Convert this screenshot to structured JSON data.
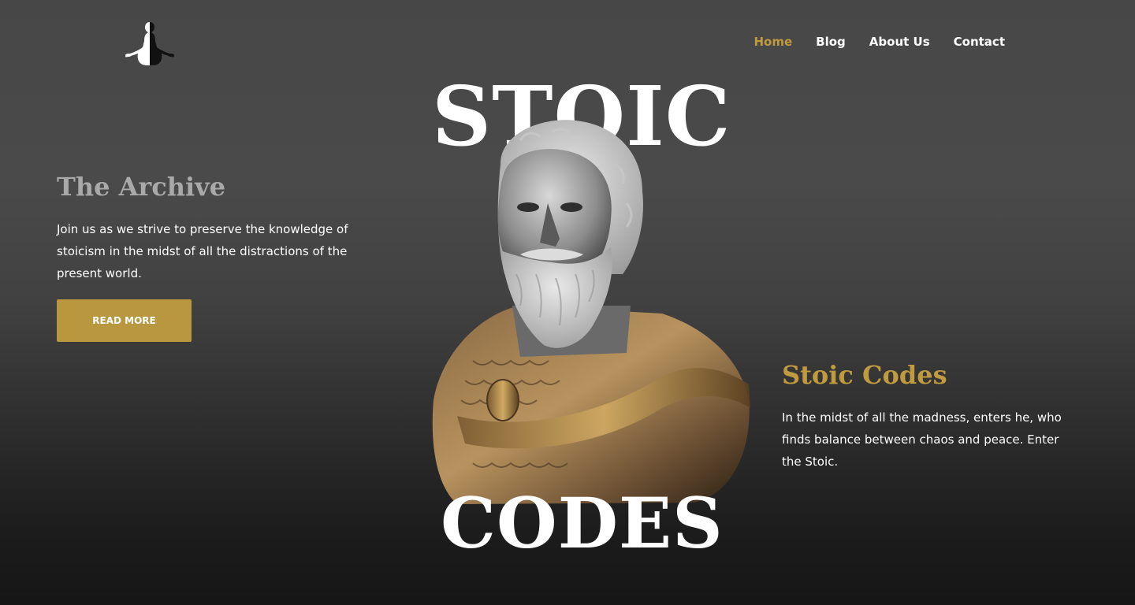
{
  "nav": {
    "items": [
      {
        "label": "Home",
        "active": true
      },
      {
        "label": "Blog",
        "active": false
      },
      {
        "label": "About Us",
        "active": false
      },
      {
        "label": "Contact",
        "active": false
      }
    ]
  },
  "hero": {
    "word_top": "STOIC",
    "word_bottom": "CODES"
  },
  "archive": {
    "title": "The Archive",
    "text": "Join us as we strive to preserve the knowledge of stoicism in the midst of all the distractions of the present world.",
    "button_label": "READ MORE"
  },
  "codes": {
    "title": "Stoic Codes",
    "text": "In the midst of all the madness, enters he, who finds balance between chaos and peace. Enter the Stoic."
  },
  "icons": {
    "logo": "meditating-figure-icon"
  },
  "colors": {
    "accent": "#c09a3f",
    "button": "#b8973f",
    "archive_title": "#a9a9a9"
  }
}
